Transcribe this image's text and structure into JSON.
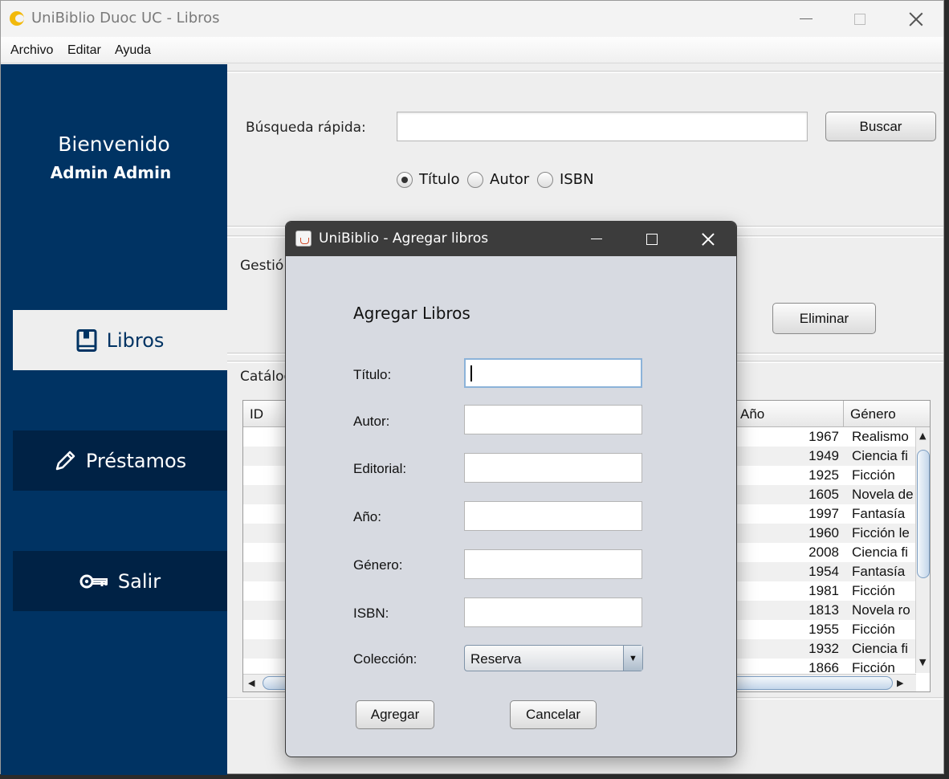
{
  "window": {
    "title": "UniBiblio Duoc UC - Libros"
  },
  "menu": [
    "Archivo",
    "Editar",
    "Ayuda"
  ],
  "sidebar": {
    "welcome": "Bienvenido",
    "user": "Admin Admin",
    "items": [
      {
        "label": "Libros",
        "icon": "book-icon"
      },
      {
        "label": "Préstamos",
        "icon": "pencil-icon"
      },
      {
        "label": "Salir",
        "icon": "key-icon"
      }
    ]
  },
  "search": {
    "label": "Búsqueda rápida:",
    "value": "",
    "button": "Buscar",
    "options": [
      {
        "label": "Título",
        "selected": true
      },
      {
        "label": "Autor",
        "selected": false
      },
      {
        "label": "ISBN",
        "selected": false
      }
    ]
  },
  "management": {
    "label_visible": "Gestió",
    "delete_button": "Eliminar"
  },
  "catalog": {
    "label_visible": "Catálog",
    "columns": {
      "id": "ID",
      "year": "Año",
      "genre": "Género"
    },
    "rows": [
      {
        "year": "1967",
        "genre": "Realismo"
      },
      {
        "year": "1949",
        "genre": "Ciencia fi"
      },
      {
        "year": "1925",
        "genre": "Ficción"
      },
      {
        "year": "1605",
        "genre": "Novela de"
      },
      {
        "year": "1997",
        "genre": "Fantasía"
      },
      {
        "year": "1960",
        "genre": "Ficción le"
      },
      {
        "year": "2008",
        "genre": "Ciencia fi"
      },
      {
        "year": "1954",
        "genre": "Fantasía"
      },
      {
        "year": "1981",
        "genre": "Ficción"
      },
      {
        "year": "1813",
        "genre": "Novela ro"
      },
      {
        "year": "1955",
        "genre": "Ficción"
      },
      {
        "year": "1932",
        "genre": "Ciencia fi"
      },
      {
        "year": "1866",
        "genre": "Ficción"
      }
    ]
  },
  "dialog": {
    "title": "UniBiblio - Agregar libros",
    "heading": "Agregar Libros",
    "fields": [
      {
        "label": "Título:",
        "value": ""
      },
      {
        "label": "Autor:",
        "value": ""
      },
      {
        "label": "Editorial:",
        "value": ""
      },
      {
        "label": "Año:",
        "value": ""
      },
      {
        "label": "Género:",
        "value": ""
      },
      {
        "label": "ISBN:",
        "value": ""
      }
    ],
    "collection_label": "Colección:",
    "collection_value": "Reserva",
    "add_button": "Agregar",
    "cancel_button": "Cancelar"
  },
  "colors": {
    "sidebar": "#003363",
    "sidebar_item": "#002245",
    "accent_icon": "#f2b90c"
  }
}
